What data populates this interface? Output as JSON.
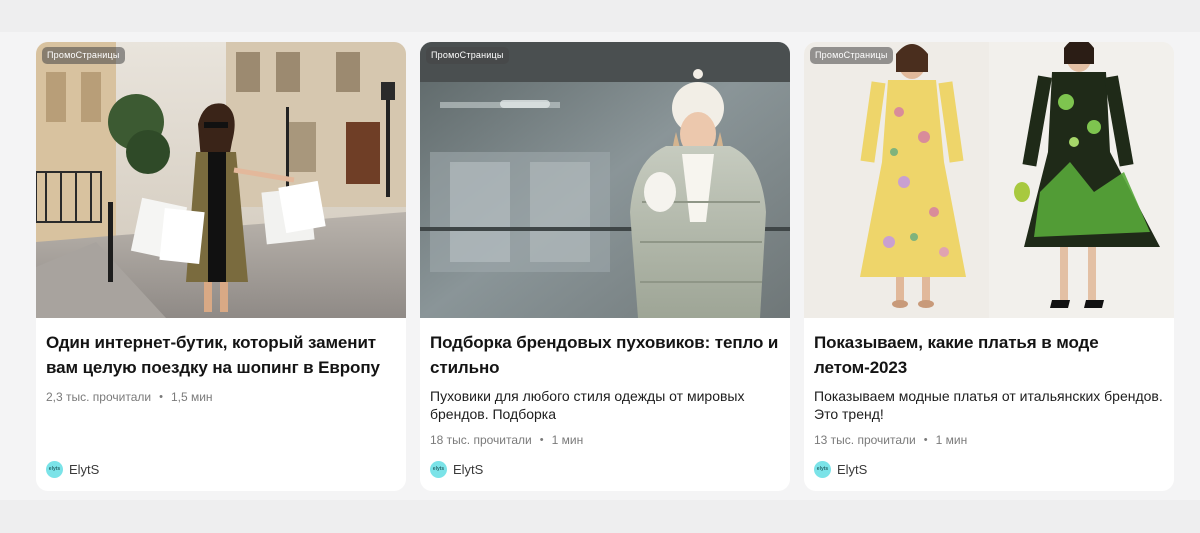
{
  "feed": {
    "cards": [
      {
        "badge": "ПромоСтраницы",
        "title": "Один интернет-бутик, который заменит вам целую поездку на шопинг в Европу",
        "subtitle": "",
        "reads": "2,3 тыс. прочитали",
        "separator": "•",
        "duration": "1,5 мин",
        "source": "ElytS",
        "avatar_text": "elyts",
        "image_icon": "woman-with-shopping-bags-photo"
      },
      {
        "badge": "ПромоСтраницы",
        "title": "Подборка брендовых пуховиков: тепло и стильно",
        "subtitle": "Пуховики для любого стиля одежды от мировых брендов. Подборка",
        "reads": "18 тыс. прочитали",
        "separator": "•",
        "duration": "1 мин",
        "source": "ElytS",
        "avatar_text": "elyts",
        "image_icon": "woman-in-puffer-jacket-photo"
      },
      {
        "badge": "ПромоСтраницы",
        "title": "Показываем, какие платья в моде летом-2023",
        "subtitle": "Показываем модные платья от итальянских брендов. Это тренд!",
        "reads": "13 тыс. прочитали",
        "separator": "•",
        "duration": "1 мин",
        "source": "ElytS",
        "avatar_text": "elyts",
        "image_icon": "two-dresses-photo"
      }
    ]
  },
  "colors": {
    "page_bg": "#eeeeef",
    "card_bg": "#ffffff",
    "title_text": "#141414",
    "meta_text": "#7a7a7a",
    "avatar_bg": "#7be3e8"
  }
}
